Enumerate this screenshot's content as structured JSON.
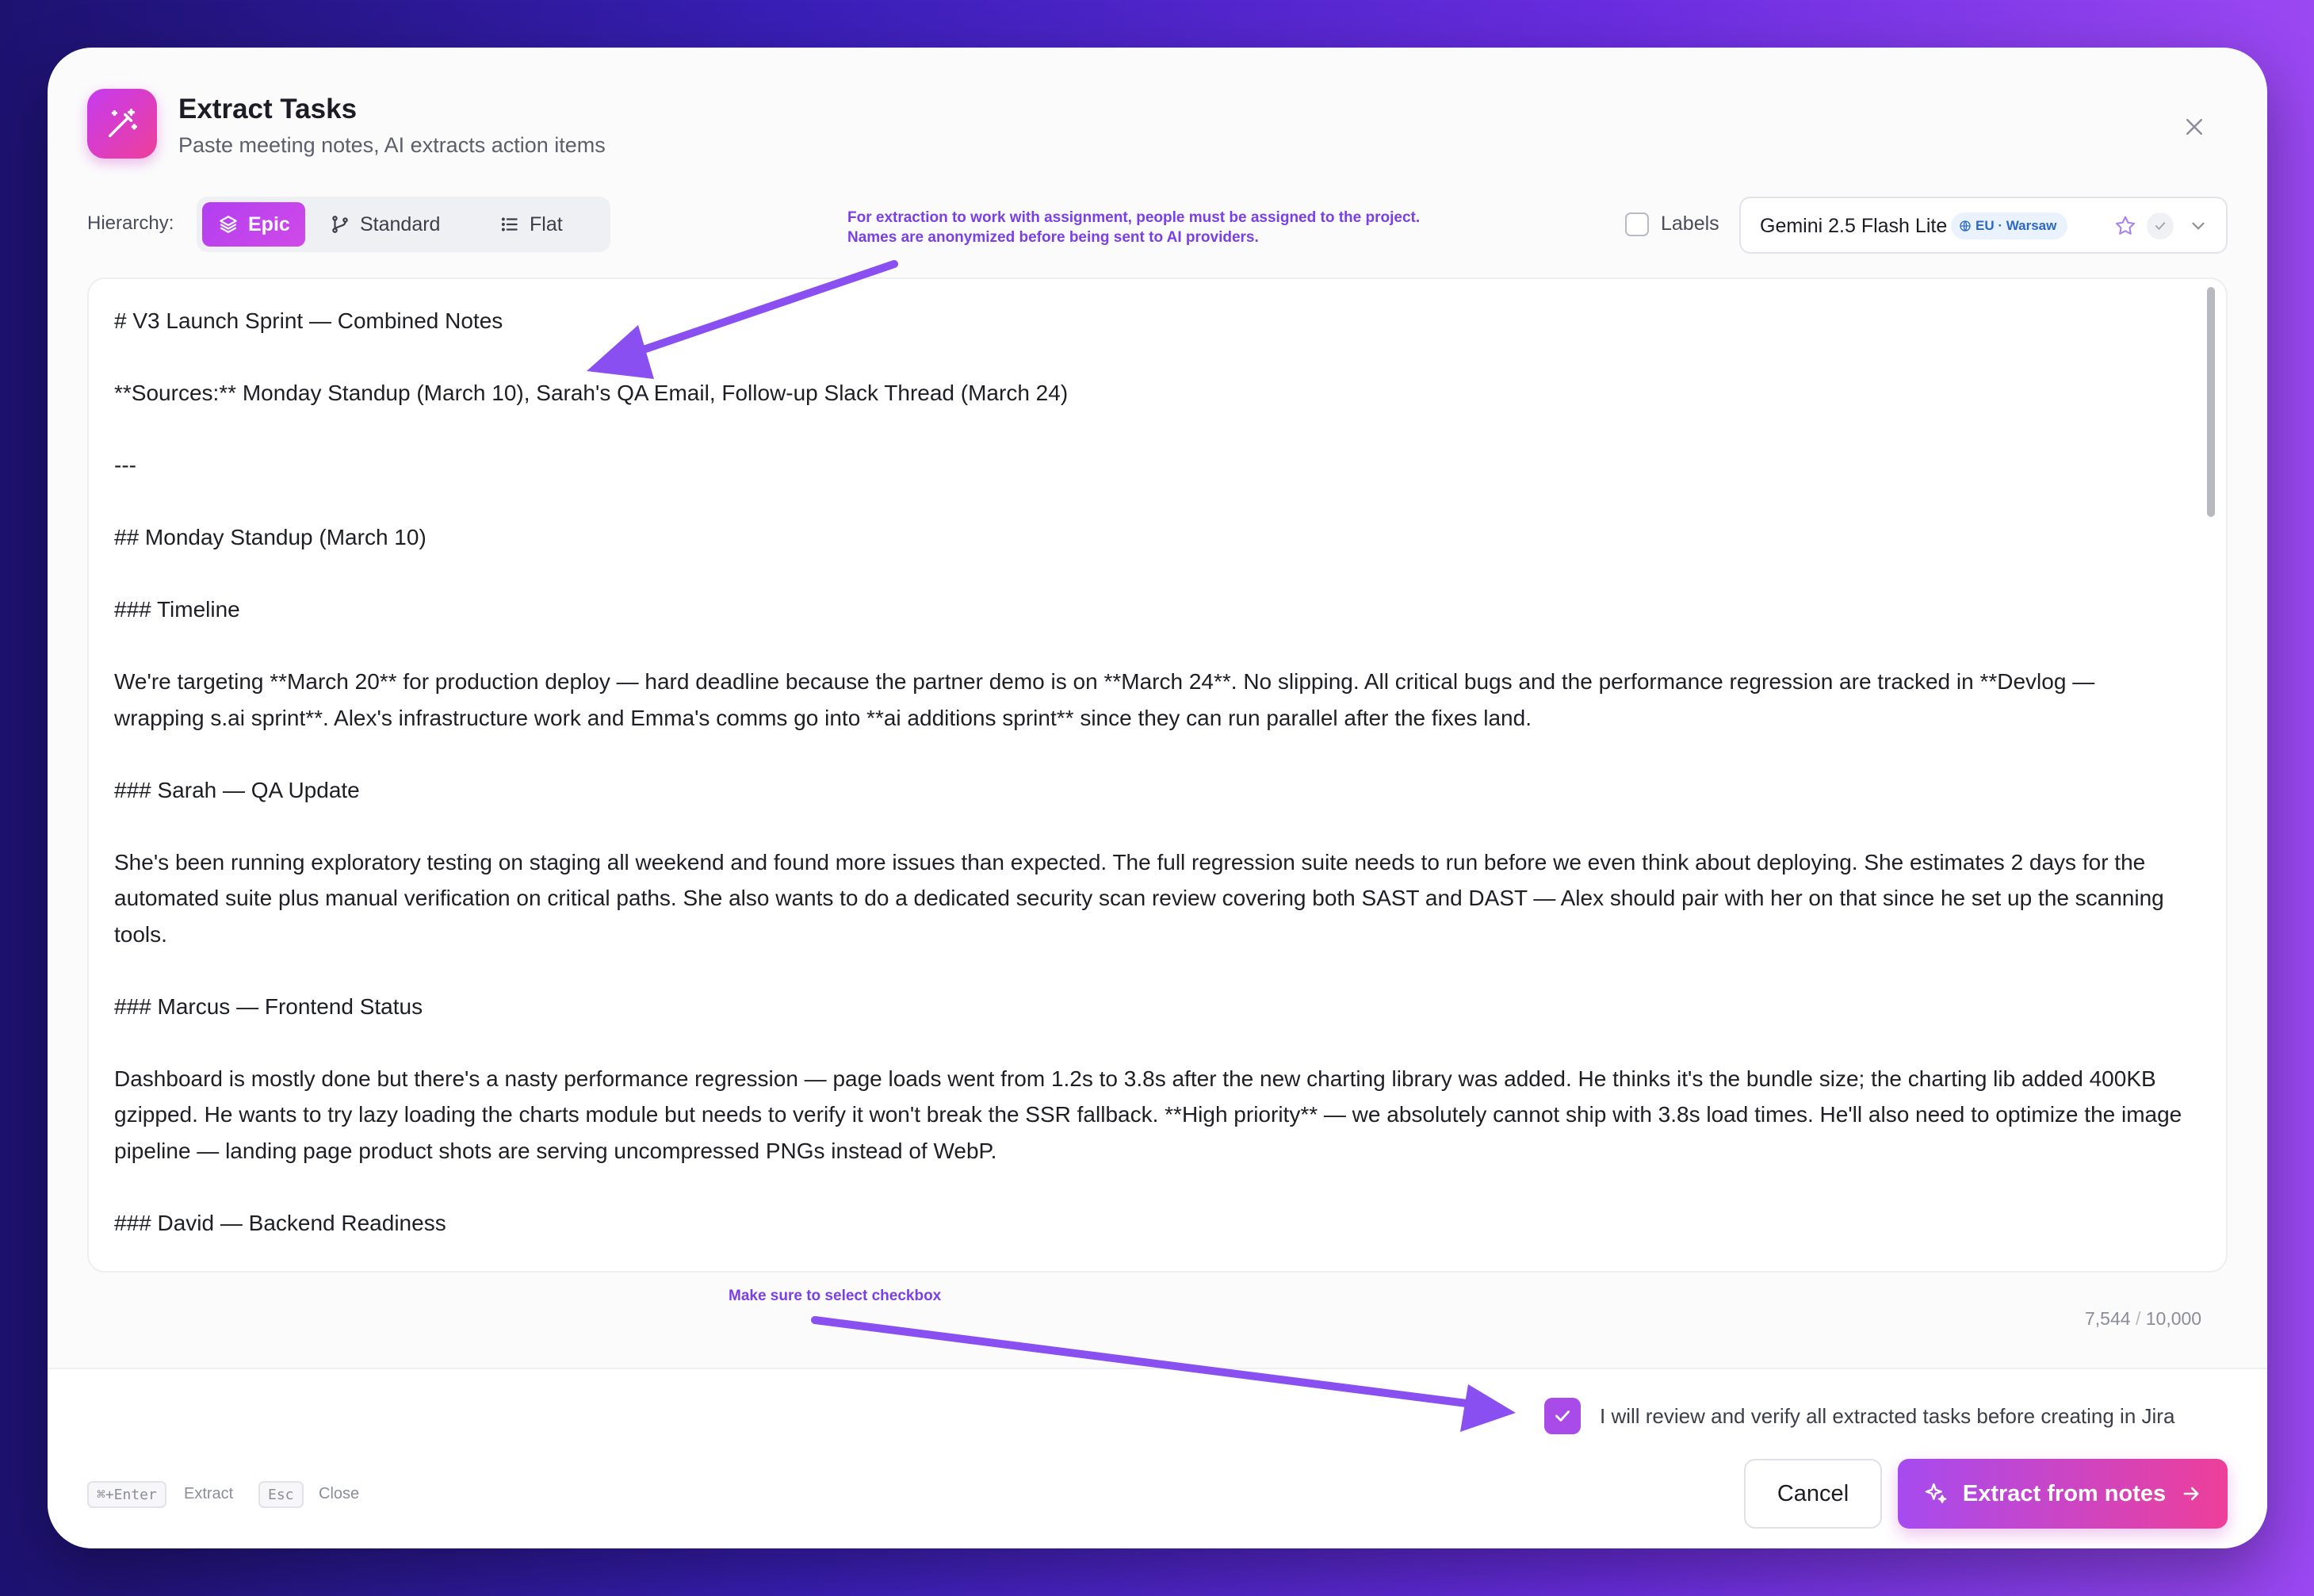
{
  "header": {
    "title": "Extract Tasks",
    "subtitle": "Paste meeting notes, AI extracts action items"
  },
  "hierarchy": {
    "label": "Hierarchy:",
    "options": [
      {
        "label": "Epic",
        "icon": "layers-icon",
        "selected": true
      },
      {
        "label": "Standard",
        "icon": "branch-icon",
        "selected": false
      },
      {
        "label": "Flat",
        "icon": "list-icon",
        "selected": false
      }
    ]
  },
  "annotations": {
    "top_line1": "For extraction to work with assignment, people must be assigned to the project.",
    "top_line2": "Names are anonymized before being sent to AI providers.",
    "bottom": "Make sure to select checkbox"
  },
  "labels_toggle": {
    "label": "Labels",
    "checked": false
  },
  "model": {
    "name": "Gemini 2.5 Flash Lite",
    "region": "EU · Warsaw"
  },
  "editor": {
    "lines": [
      "# V3 Launch Sprint — Combined Notes",
      "**Sources:** Monday Standup (March 10), Sarah's QA Email, Follow-up Slack Thread (March 24)",
      "---",
      "## Monday Standup (March 10)",
      "### Timeline",
      "We're targeting **March 20** for production deploy — hard deadline because the partner demo is on **March 24**. No slipping. All critical bugs and the performance regression are tracked in **Devlog — wrapping s.ai sprint**. Alex's infrastructure work and Emma's comms go into **ai additions sprint** since they can run parallel after the fixes land.",
      "### Sarah — QA Update",
      "She's been running exploratory testing on staging all weekend and found more issues than expected. The full regression suite needs to run before we even think about deploying. She estimates 2 days for the automated suite plus manual verification on critical paths. She also wants to do a dedicated security scan review covering both SAST and DAST — Alex should pair with her on that since he set up the scanning tools.",
      "### Marcus — Frontend Status",
      "Dashboard is mostly done but there's a nasty performance regression — page loads went from 1.2s to 3.8s after the new charting library was added. He thinks it's the bundle size; the charting lib added 400KB gzipped. He wants to try lazy loading the charts module but needs to verify it won't break the SSR fallback. **High priority** — we absolutely cannot ship with 3.8s load times. He'll also need to optimize the image pipeline — landing page product shots are serving uncompressed PNGs instead of WebP.",
      "### David — Backend Readiness"
    ],
    "char_count": "7,544",
    "char_limit": "10,000"
  },
  "footer": {
    "agreement": "I will review and verify all extracted tasks before creating in Jira",
    "agreement_checked": true,
    "shortcuts": [
      {
        "key": "⌘+Enter",
        "label": "Extract"
      },
      {
        "key": "Esc",
        "label": "Close"
      }
    ],
    "cancel_label": "Cancel",
    "primary_label": "Extract from notes"
  },
  "colors": {
    "accent": "#a84be8",
    "brand_pink": "#ee3f9a",
    "annotation": "#7a3fe6"
  }
}
